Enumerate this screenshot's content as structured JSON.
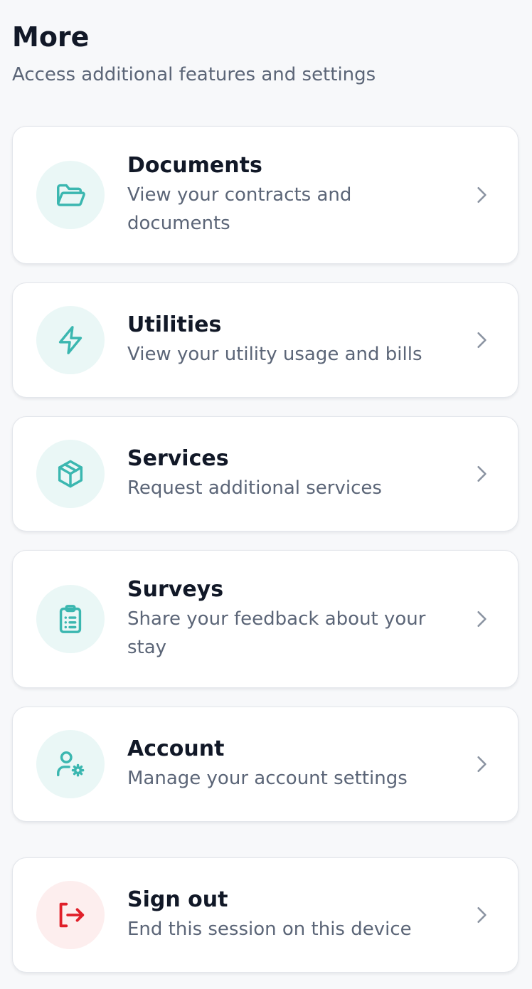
{
  "header": {
    "title": "More",
    "subtitle": "Access additional features and settings"
  },
  "items": [
    {
      "id": "documents",
      "title": "Documents",
      "description": "View your contracts and documents",
      "icon": "folder-icon"
    },
    {
      "id": "utilities",
      "title": "Utilities",
      "description": "View your utility usage and bills",
      "icon": "lightning-icon"
    },
    {
      "id": "services",
      "title": "Services",
      "description": "Request additional services",
      "icon": "package-icon"
    },
    {
      "id": "surveys",
      "title": "Surveys",
      "description": "Share your feedback about your stay",
      "icon": "clipboard-list-icon"
    },
    {
      "id": "account",
      "title": "Account",
      "description": "Manage your account settings",
      "icon": "user-settings-icon"
    }
  ],
  "sign_out": {
    "title": "Sign out",
    "description": "End this session on this device",
    "icon": "sign-out-icon"
  },
  "colors": {
    "accent": "#3bb7b0",
    "accent_bg": "#eaf7f6",
    "danger": "#e0202a",
    "danger_bg": "#fdeeee",
    "chevron": "#8a93a1",
    "background": "#f7f8fa",
    "title_text": "#111827",
    "secondary_text": "#5b6577"
  }
}
